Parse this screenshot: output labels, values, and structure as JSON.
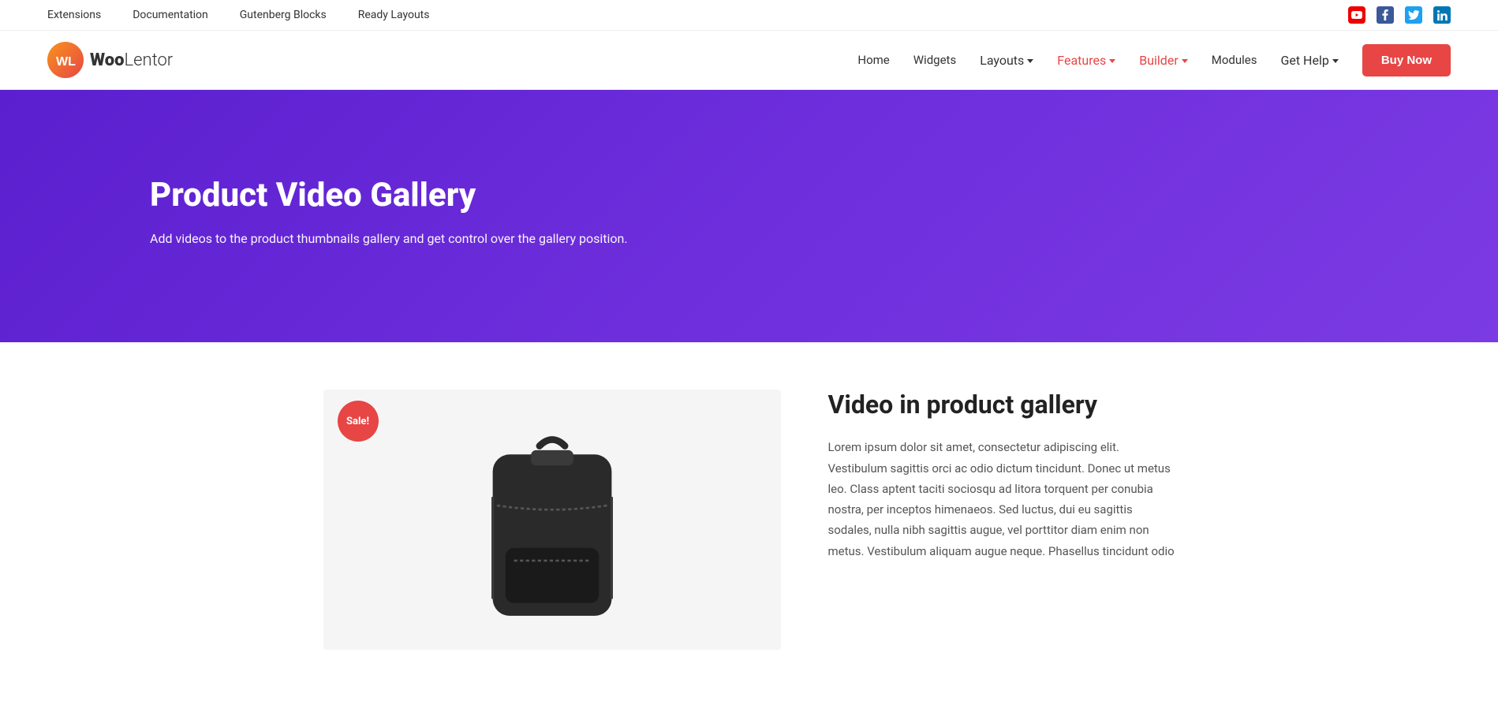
{
  "topbar": {
    "nav": [
      {
        "label": "Extensions",
        "url": "#"
      },
      {
        "label": "Documentation",
        "url": "#"
      },
      {
        "label": "Gutenberg Blocks",
        "url": "#"
      },
      {
        "label": "Ready Layouts",
        "url": "#"
      }
    ],
    "social": [
      {
        "name": "youtube",
        "label": "YT"
      },
      {
        "name": "facebook",
        "label": "f"
      },
      {
        "name": "twitter",
        "label": "t"
      },
      {
        "name": "linkedin",
        "label": "in"
      }
    ]
  },
  "header": {
    "logo_wl": "WL",
    "logo_name_woo": "Woo",
    "logo_name_lentor": "Lentor",
    "nav": [
      {
        "label": "Home",
        "active": false,
        "hasArrow": false
      },
      {
        "label": "Widgets",
        "active": false,
        "hasArrow": false
      },
      {
        "label": "Layouts",
        "active": false,
        "hasArrow": true
      },
      {
        "label": "Features",
        "active": true,
        "hasArrow": true
      },
      {
        "label": "Builder",
        "active": true,
        "hasArrow": true
      },
      {
        "label": "Modules",
        "active": false,
        "hasArrow": false
      },
      {
        "label": "Get Help",
        "active": false,
        "hasArrow": true
      }
    ],
    "buy_now": "Buy Now"
  },
  "hero": {
    "title": "Product Video Gallery",
    "subtitle": "Add videos to the product thumbnails gallery and get control over the gallery position."
  },
  "product": {
    "sale_badge": "Sale!",
    "info_title": "Video in product gallery",
    "info_text": "Lorem ipsum dolor sit amet, consectetur adipiscing elit. Vestibulum sagittis orci ac odio dictum tincidunt. Donec ut metus leo. Class aptent taciti sociosqu ad litora torquent per conubia nostra, per inceptos himenaeos. Sed luctus, dui eu sagittis sodales, nulla nibh sagittis augue, vel porttitor diam enim non metus. Vestibulum aliquam augue neque. Phasellus tincidunt odio"
  }
}
